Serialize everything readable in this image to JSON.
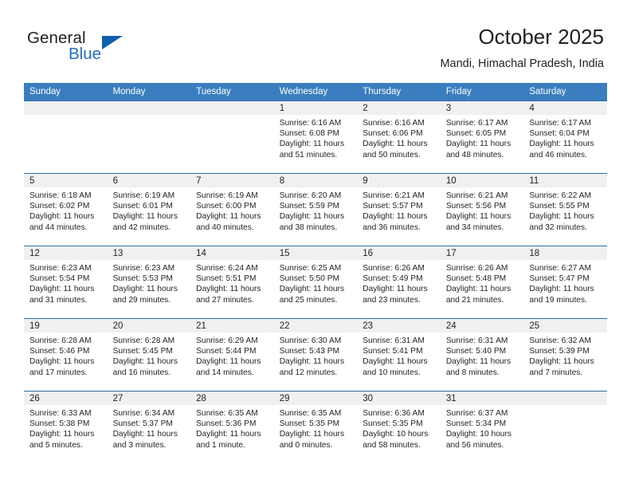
{
  "brand": {
    "name_part1": "General",
    "name_part2": "Blue",
    "accent_color": "#1f6fc4",
    "triangle_color": "#0f5fae"
  },
  "header": {
    "title": "October 2025",
    "subtitle": "Mandi, Himachal Pradesh, India"
  },
  "calendar": {
    "header_bg": "#3a7ebf",
    "row_divider_color": "#2e6da4",
    "daynum_bg": "#f0f0f0",
    "weekdays": [
      "Sunday",
      "Monday",
      "Tuesday",
      "Wednesday",
      "Thursday",
      "Friday",
      "Saturday"
    ],
    "weeks": [
      [
        {
          "day": "",
          "empty": true
        },
        {
          "day": "",
          "empty": true
        },
        {
          "day": "",
          "empty": true
        },
        {
          "day": "1",
          "sunrise": "Sunrise: 6:16 AM",
          "sunset": "Sunset: 6:08 PM",
          "daylight1": "Daylight: 11 hours",
          "daylight2": "and 51 minutes."
        },
        {
          "day": "2",
          "sunrise": "Sunrise: 6:16 AM",
          "sunset": "Sunset: 6:06 PM",
          "daylight1": "Daylight: 11 hours",
          "daylight2": "and 50 minutes."
        },
        {
          "day": "3",
          "sunrise": "Sunrise: 6:17 AM",
          "sunset": "Sunset: 6:05 PM",
          "daylight1": "Daylight: 11 hours",
          "daylight2": "and 48 minutes."
        },
        {
          "day": "4",
          "sunrise": "Sunrise: 6:17 AM",
          "sunset": "Sunset: 6:04 PM",
          "daylight1": "Daylight: 11 hours",
          "daylight2": "and 46 minutes."
        }
      ],
      [
        {
          "day": "5",
          "sunrise": "Sunrise: 6:18 AM",
          "sunset": "Sunset: 6:02 PM",
          "daylight1": "Daylight: 11 hours",
          "daylight2": "and 44 minutes."
        },
        {
          "day": "6",
          "sunrise": "Sunrise: 6:19 AM",
          "sunset": "Sunset: 6:01 PM",
          "daylight1": "Daylight: 11 hours",
          "daylight2": "and 42 minutes."
        },
        {
          "day": "7",
          "sunrise": "Sunrise: 6:19 AM",
          "sunset": "Sunset: 6:00 PM",
          "daylight1": "Daylight: 11 hours",
          "daylight2": "and 40 minutes."
        },
        {
          "day": "8",
          "sunrise": "Sunrise: 6:20 AM",
          "sunset": "Sunset: 5:59 PM",
          "daylight1": "Daylight: 11 hours",
          "daylight2": "and 38 minutes."
        },
        {
          "day": "9",
          "sunrise": "Sunrise: 6:21 AM",
          "sunset": "Sunset: 5:57 PM",
          "daylight1": "Daylight: 11 hours",
          "daylight2": "and 36 minutes."
        },
        {
          "day": "10",
          "sunrise": "Sunrise: 6:21 AM",
          "sunset": "Sunset: 5:56 PM",
          "daylight1": "Daylight: 11 hours",
          "daylight2": "and 34 minutes."
        },
        {
          "day": "11",
          "sunrise": "Sunrise: 6:22 AM",
          "sunset": "Sunset: 5:55 PM",
          "daylight1": "Daylight: 11 hours",
          "daylight2": "and 32 minutes."
        }
      ],
      [
        {
          "day": "12",
          "sunrise": "Sunrise: 6:23 AM",
          "sunset": "Sunset: 5:54 PM",
          "daylight1": "Daylight: 11 hours",
          "daylight2": "and 31 minutes."
        },
        {
          "day": "13",
          "sunrise": "Sunrise: 6:23 AM",
          "sunset": "Sunset: 5:53 PM",
          "daylight1": "Daylight: 11 hours",
          "daylight2": "and 29 minutes."
        },
        {
          "day": "14",
          "sunrise": "Sunrise: 6:24 AM",
          "sunset": "Sunset: 5:51 PM",
          "daylight1": "Daylight: 11 hours",
          "daylight2": "and 27 minutes."
        },
        {
          "day": "15",
          "sunrise": "Sunrise: 6:25 AM",
          "sunset": "Sunset: 5:50 PM",
          "daylight1": "Daylight: 11 hours",
          "daylight2": "and 25 minutes."
        },
        {
          "day": "16",
          "sunrise": "Sunrise: 6:26 AM",
          "sunset": "Sunset: 5:49 PM",
          "daylight1": "Daylight: 11 hours",
          "daylight2": "and 23 minutes."
        },
        {
          "day": "17",
          "sunrise": "Sunrise: 6:26 AM",
          "sunset": "Sunset: 5:48 PM",
          "daylight1": "Daylight: 11 hours",
          "daylight2": "and 21 minutes."
        },
        {
          "day": "18",
          "sunrise": "Sunrise: 6:27 AM",
          "sunset": "Sunset: 5:47 PM",
          "daylight1": "Daylight: 11 hours",
          "daylight2": "and 19 minutes."
        }
      ],
      [
        {
          "day": "19",
          "sunrise": "Sunrise: 6:28 AM",
          "sunset": "Sunset: 5:46 PM",
          "daylight1": "Daylight: 11 hours",
          "daylight2": "and 17 minutes."
        },
        {
          "day": "20",
          "sunrise": "Sunrise: 6:28 AM",
          "sunset": "Sunset: 5:45 PM",
          "daylight1": "Daylight: 11 hours",
          "daylight2": "and 16 minutes."
        },
        {
          "day": "21",
          "sunrise": "Sunrise: 6:29 AM",
          "sunset": "Sunset: 5:44 PM",
          "daylight1": "Daylight: 11 hours",
          "daylight2": "and 14 minutes."
        },
        {
          "day": "22",
          "sunrise": "Sunrise: 6:30 AM",
          "sunset": "Sunset: 5:43 PM",
          "daylight1": "Daylight: 11 hours",
          "daylight2": "and 12 minutes."
        },
        {
          "day": "23",
          "sunrise": "Sunrise: 6:31 AM",
          "sunset": "Sunset: 5:41 PM",
          "daylight1": "Daylight: 11 hours",
          "daylight2": "and 10 minutes."
        },
        {
          "day": "24",
          "sunrise": "Sunrise: 6:31 AM",
          "sunset": "Sunset: 5:40 PM",
          "daylight1": "Daylight: 11 hours",
          "daylight2": "and 8 minutes."
        },
        {
          "day": "25",
          "sunrise": "Sunrise: 6:32 AM",
          "sunset": "Sunset: 5:39 PM",
          "daylight1": "Daylight: 11 hours",
          "daylight2": "and 7 minutes."
        }
      ],
      [
        {
          "day": "26",
          "sunrise": "Sunrise: 6:33 AM",
          "sunset": "Sunset: 5:38 PM",
          "daylight1": "Daylight: 11 hours",
          "daylight2": "and 5 minutes."
        },
        {
          "day": "27",
          "sunrise": "Sunrise: 6:34 AM",
          "sunset": "Sunset: 5:37 PM",
          "daylight1": "Daylight: 11 hours",
          "daylight2": "and 3 minutes."
        },
        {
          "day": "28",
          "sunrise": "Sunrise: 6:35 AM",
          "sunset": "Sunset: 5:36 PM",
          "daylight1": "Daylight: 11 hours",
          "daylight2": "and 1 minute."
        },
        {
          "day": "29",
          "sunrise": "Sunrise: 6:35 AM",
          "sunset": "Sunset: 5:35 PM",
          "daylight1": "Daylight: 11 hours",
          "daylight2": "and 0 minutes."
        },
        {
          "day": "30",
          "sunrise": "Sunrise: 6:36 AM",
          "sunset": "Sunset: 5:35 PM",
          "daylight1": "Daylight: 10 hours",
          "daylight2": "and 58 minutes."
        },
        {
          "day": "31",
          "sunrise": "Sunrise: 6:37 AM",
          "sunset": "Sunset: 5:34 PM",
          "daylight1": "Daylight: 10 hours",
          "daylight2": "and 56 minutes."
        },
        {
          "day": "",
          "empty": true
        }
      ]
    ]
  }
}
